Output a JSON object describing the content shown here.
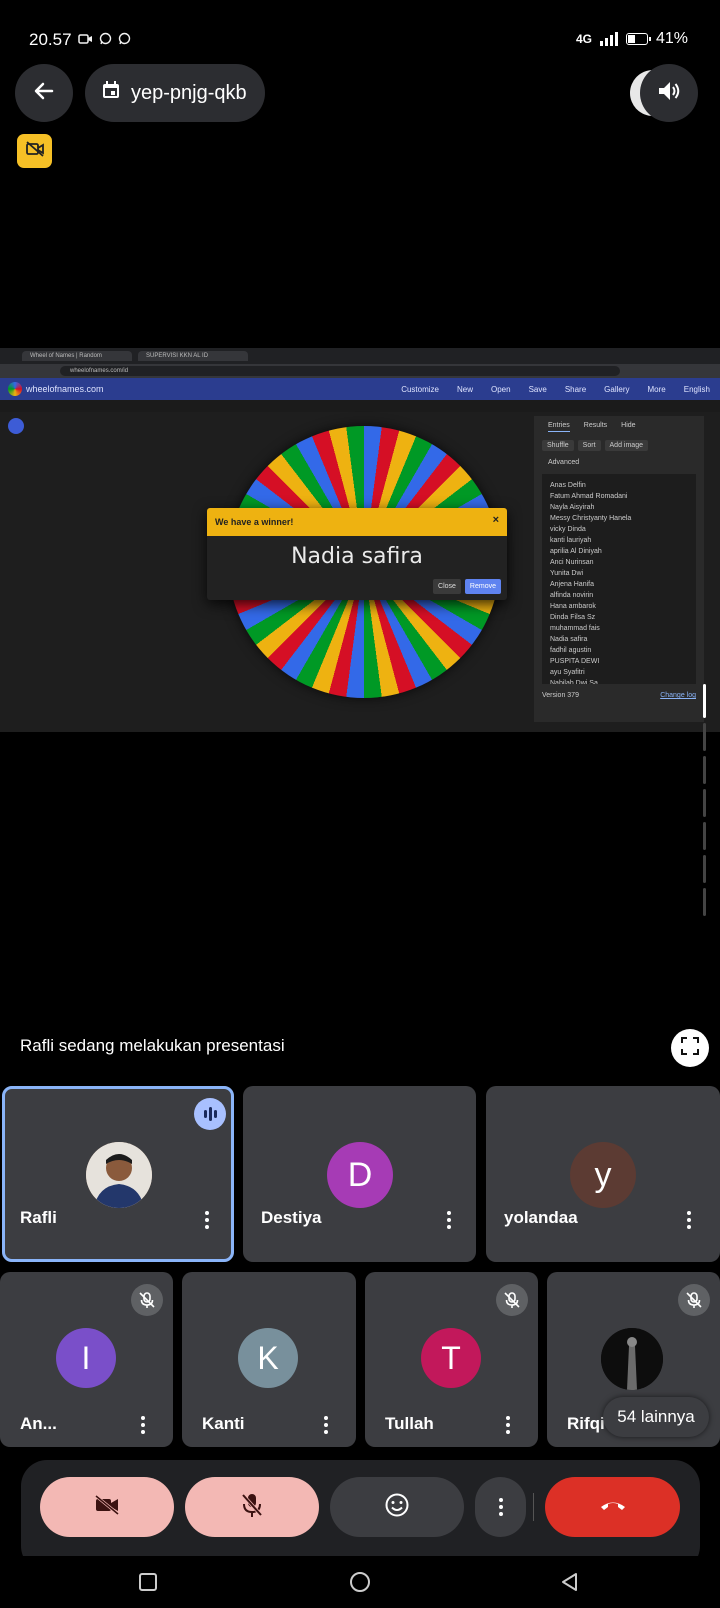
{
  "status_bar": {
    "time": "20.57",
    "network": "4G",
    "battery": "41%",
    "battery_level": 0.41,
    "notification_icons": [
      "video-camera-icon",
      "whatsapp-icon",
      "whatsapp-icon"
    ]
  },
  "header": {
    "meeting_code": "yep-pnjg-qkb"
  },
  "shared_screen": {
    "tabs": [
      "Wheel of Names | Random",
      "SUPERVISI KKN AL ID"
    ],
    "url": "wheelofnames.com/id",
    "site_name": "wheelofnames.com",
    "nav_items": [
      "Customize",
      "New",
      "Open",
      "Save",
      "Share",
      "Gallery",
      "More",
      "English"
    ],
    "dialog": {
      "title": "We have a winner!",
      "winner": "Nadia safira",
      "close_label": "Close",
      "remove_label": "Remove"
    },
    "sidebar": {
      "tab_entries": "Entries",
      "tab_results": "Results",
      "hide": "Hide",
      "shuffle": "Shuffle",
      "sort": "Sort",
      "add_image": "Add image",
      "advanced": "Advanced",
      "entries": [
        "Anas Delfin",
        "Fatum Ahmad Romadani",
        "Nayla Aisyirah",
        "Messy Christyanty Hanela",
        "vicky Dinda",
        "kanti lauriyah",
        "aprilia Al Diniyah",
        "Anci Nurinsan",
        "Yunita Dwi",
        "Anjena Hanifa",
        "alfinda novirin",
        "Hana ambarok",
        "Dinda Filsa Sz",
        "muhammad fais",
        "Nadia safira",
        "fadhil agustin",
        "PUSPITA DEWI",
        "ayu Syafitri",
        "Nabilah Dwi Sa"
      ],
      "version": "Version 379",
      "change_log": "Change log"
    }
  },
  "presentation": {
    "presenting_text": "Rafli sedang melakukan presentasi"
  },
  "participants": {
    "row1": [
      {
        "name": "Rafli",
        "initial": "",
        "color": "#c79a7a",
        "speaking": true
      },
      {
        "name": "Destiya",
        "initial": "D",
        "color": "#a63bb5"
      },
      {
        "name": "yolandaa",
        "initial": "y",
        "color": "#5c3b33"
      }
    ],
    "row2": [
      {
        "name": "An...",
        "initial": "I",
        "color": "#7a4fc9",
        "muted": true
      },
      {
        "name": "Kanti",
        "initial": "K",
        "color": "#78909c",
        "muted": false
      },
      {
        "name": "Tullah",
        "initial": "T",
        "color": "#c2185b",
        "muted": true
      },
      {
        "name": "Rifqi",
        "initial": "",
        "color": "#111111",
        "muted": true
      }
    ],
    "more_label": "54 lainnya"
  },
  "controls": {
    "accent_pink": "#f3b8b4",
    "accent_red": "#dc3026"
  }
}
